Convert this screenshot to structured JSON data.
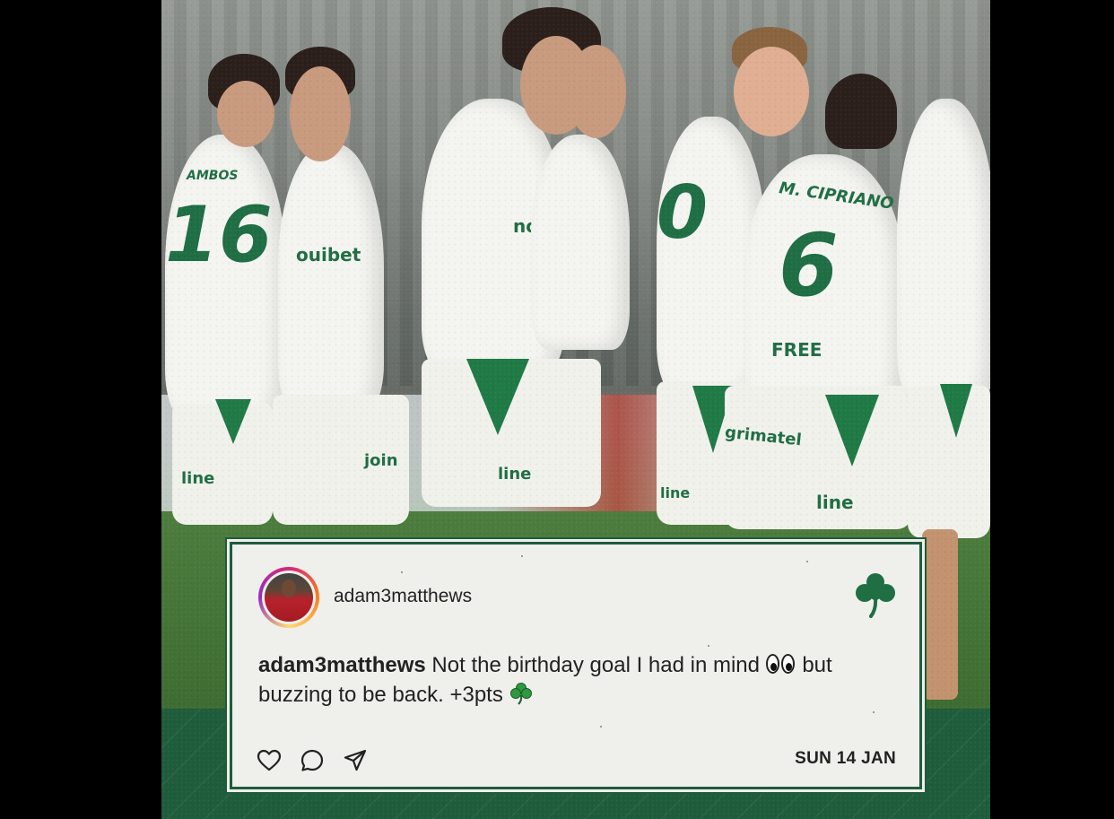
{
  "post": {
    "username": "adam3matthews",
    "caption_handle": "adam3matthews",
    "caption_part1": "Not the birthday goal I had in mind",
    "caption_part2": "but buzzing to be back. +3pts",
    "date": "SUN 14 JAN"
  },
  "icons": {
    "top_right": "shamrock-icon",
    "emoji_1": "eyes-emoji-icon",
    "emoji_2": "shamrock-emoji-icon",
    "actions": [
      "heart-icon",
      "comment-icon",
      "share-icon"
    ]
  },
  "photo": {
    "jerseys": [
      {
        "number": "16",
        "name": "AMBOS"
      },
      {
        "number": "6",
        "name": "M. CIPRIANO"
      },
      {
        "number": "0",
        "name": ""
      }
    ],
    "sponsors": [
      "ouibet",
      "FREE",
      "line",
      "join",
      "grimatel",
      "no"
    ]
  },
  "colors": {
    "brand_green": "#1f5c3c",
    "card_bg": "#efefec",
    "jersey_white": "#f4f4f0",
    "jersey_green": "#1f6e44"
  }
}
